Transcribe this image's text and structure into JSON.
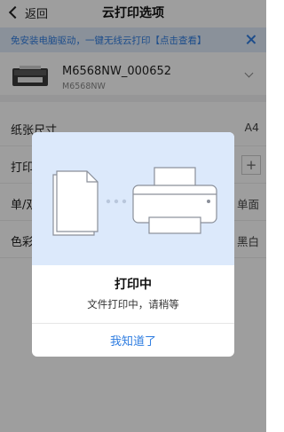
{
  "nav": {
    "back_label": "返回",
    "title": "云打印选项"
  },
  "banner": {
    "text": "免安装电脑驱动，一键无线云打印【点击查看】"
  },
  "printer": {
    "name": "M6568NW_000652",
    "model": "M6568NW"
  },
  "settings": [
    {
      "label": "纸张尺寸",
      "value": "A4"
    },
    {
      "label": "打印",
      "value": ""
    },
    {
      "label": "单/双",
      "value": "单面"
    },
    {
      "label": "色彩",
      "value": "黑白"
    }
  ],
  "dialog": {
    "title": "打印中",
    "message": "文件打印中，请稍等",
    "button_label": "我知道了"
  },
  "colors": {
    "accent": "#2f7de1",
    "banner_bg": "#dfeaf8",
    "dialog_art_bg": "#dce9fb"
  }
}
